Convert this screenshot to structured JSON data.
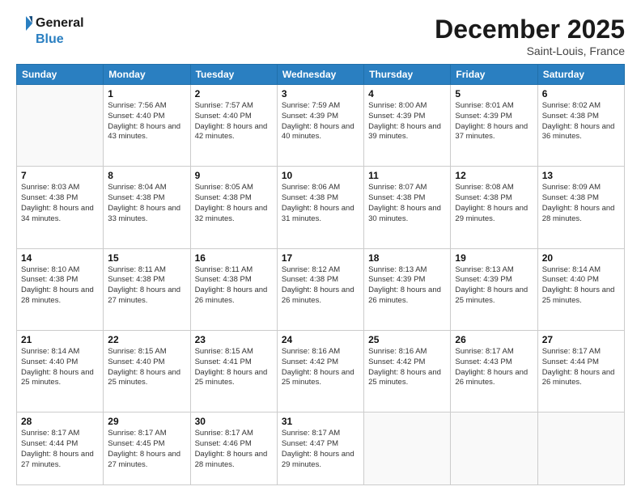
{
  "logo": {
    "line1": "General",
    "line2": "Blue"
  },
  "header": {
    "month": "December 2025",
    "location": "Saint-Louis, France"
  },
  "weekdays": [
    "Sunday",
    "Monday",
    "Tuesday",
    "Wednesday",
    "Thursday",
    "Friday",
    "Saturday"
  ],
  "weeks": [
    [
      {
        "day": "",
        "sunrise": "",
        "sunset": "",
        "daylight": ""
      },
      {
        "day": "1",
        "sunrise": "Sunrise: 7:56 AM",
        "sunset": "Sunset: 4:40 PM",
        "daylight": "Daylight: 8 hours and 43 minutes."
      },
      {
        "day": "2",
        "sunrise": "Sunrise: 7:57 AM",
        "sunset": "Sunset: 4:40 PM",
        "daylight": "Daylight: 8 hours and 42 minutes."
      },
      {
        "day": "3",
        "sunrise": "Sunrise: 7:59 AM",
        "sunset": "Sunset: 4:39 PM",
        "daylight": "Daylight: 8 hours and 40 minutes."
      },
      {
        "day": "4",
        "sunrise": "Sunrise: 8:00 AM",
        "sunset": "Sunset: 4:39 PM",
        "daylight": "Daylight: 8 hours and 39 minutes."
      },
      {
        "day": "5",
        "sunrise": "Sunrise: 8:01 AM",
        "sunset": "Sunset: 4:39 PM",
        "daylight": "Daylight: 8 hours and 37 minutes."
      },
      {
        "day": "6",
        "sunrise": "Sunrise: 8:02 AM",
        "sunset": "Sunset: 4:38 PM",
        "daylight": "Daylight: 8 hours and 36 minutes."
      }
    ],
    [
      {
        "day": "7",
        "sunrise": "Sunrise: 8:03 AM",
        "sunset": "Sunset: 4:38 PM",
        "daylight": "Daylight: 8 hours and 34 minutes."
      },
      {
        "day": "8",
        "sunrise": "Sunrise: 8:04 AM",
        "sunset": "Sunset: 4:38 PM",
        "daylight": "Daylight: 8 hours and 33 minutes."
      },
      {
        "day": "9",
        "sunrise": "Sunrise: 8:05 AM",
        "sunset": "Sunset: 4:38 PM",
        "daylight": "Daylight: 8 hours and 32 minutes."
      },
      {
        "day": "10",
        "sunrise": "Sunrise: 8:06 AM",
        "sunset": "Sunset: 4:38 PM",
        "daylight": "Daylight: 8 hours and 31 minutes."
      },
      {
        "day": "11",
        "sunrise": "Sunrise: 8:07 AM",
        "sunset": "Sunset: 4:38 PM",
        "daylight": "Daylight: 8 hours and 30 minutes."
      },
      {
        "day": "12",
        "sunrise": "Sunrise: 8:08 AM",
        "sunset": "Sunset: 4:38 PM",
        "daylight": "Daylight: 8 hours and 29 minutes."
      },
      {
        "day": "13",
        "sunrise": "Sunrise: 8:09 AM",
        "sunset": "Sunset: 4:38 PM",
        "daylight": "Daylight: 8 hours and 28 minutes."
      }
    ],
    [
      {
        "day": "14",
        "sunrise": "Sunrise: 8:10 AM",
        "sunset": "Sunset: 4:38 PM",
        "daylight": "Daylight: 8 hours and 28 minutes."
      },
      {
        "day": "15",
        "sunrise": "Sunrise: 8:11 AM",
        "sunset": "Sunset: 4:38 PM",
        "daylight": "Daylight: 8 hours and 27 minutes."
      },
      {
        "day": "16",
        "sunrise": "Sunrise: 8:11 AM",
        "sunset": "Sunset: 4:38 PM",
        "daylight": "Daylight: 8 hours and 26 minutes."
      },
      {
        "day": "17",
        "sunrise": "Sunrise: 8:12 AM",
        "sunset": "Sunset: 4:38 PM",
        "daylight": "Daylight: 8 hours and 26 minutes."
      },
      {
        "day": "18",
        "sunrise": "Sunrise: 8:13 AM",
        "sunset": "Sunset: 4:39 PM",
        "daylight": "Daylight: 8 hours and 26 minutes."
      },
      {
        "day": "19",
        "sunrise": "Sunrise: 8:13 AM",
        "sunset": "Sunset: 4:39 PM",
        "daylight": "Daylight: 8 hours and 25 minutes."
      },
      {
        "day": "20",
        "sunrise": "Sunrise: 8:14 AM",
        "sunset": "Sunset: 4:40 PM",
        "daylight": "Daylight: 8 hours and 25 minutes."
      }
    ],
    [
      {
        "day": "21",
        "sunrise": "Sunrise: 8:14 AM",
        "sunset": "Sunset: 4:40 PM",
        "daylight": "Daylight: 8 hours and 25 minutes."
      },
      {
        "day": "22",
        "sunrise": "Sunrise: 8:15 AM",
        "sunset": "Sunset: 4:40 PM",
        "daylight": "Daylight: 8 hours and 25 minutes."
      },
      {
        "day": "23",
        "sunrise": "Sunrise: 8:15 AM",
        "sunset": "Sunset: 4:41 PM",
        "daylight": "Daylight: 8 hours and 25 minutes."
      },
      {
        "day": "24",
        "sunrise": "Sunrise: 8:16 AM",
        "sunset": "Sunset: 4:42 PM",
        "daylight": "Daylight: 8 hours and 25 minutes."
      },
      {
        "day": "25",
        "sunrise": "Sunrise: 8:16 AM",
        "sunset": "Sunset: 4:42 PM",
        "daylight": "Daylight: 8 hours and 25 minutes."
      },
      {
        "day": "26",
        "sunrise": "Sunrise: 8:17 AM",
        "sunset": "Sunset: 4:43 PM",
        "daylight": "Daylight: 8 hours and 26 minutes."
      },
      {
        "day": "27",
        "sunrise": "Sunrise: 8:17 AM",
        "sunset": "Sunset: 4:44 PM",
        "daylight": "Daylight: 8 hours and 26 minutes."
      }
    ],
    [
      {
        "day": "28",
        "sunrise": "Sunrise: 8:17 AM",
        "sunset": "Sunset: 4:44 PM",
        "daylight": "Daylight: 8 hours and 27 minutes."
      },
      {
        "day": "29",
        "sunrise": "Sunrise: 8:17 AM",
        "sunset": "Sunset: 4:45 PM",
        "daylight": "Daylight: 8 hours and 27 minutes."
      },
      {
        "day": "30",
        "sunrise": "Sunrise: 8:17 AM",
        "sunset": "Sunset: 4:46 PM",
        "daylight": "Daylight: 8 hours and 28 minutes."
      },
      {
        "day": "31",
        "sunrise": "Sunrise: 8:17 AM",
        "sunset": "Sunset: 4:47 PM",
        "daylight": "Daylight: 8 hours and 29 minutes."
      },
      {
        "day": "",
        "sunrise": "",
        "sunset": "",
        "daylight": ""
      },
      {
        "day": "",
        "sunrise": "",
        "sunset": "",
        "daylight": ""
      },
      {
        "day": "",
        "sunrise": "",
        "sunset": "",
        "daylight": ""
      }
    ]
  ]
}
